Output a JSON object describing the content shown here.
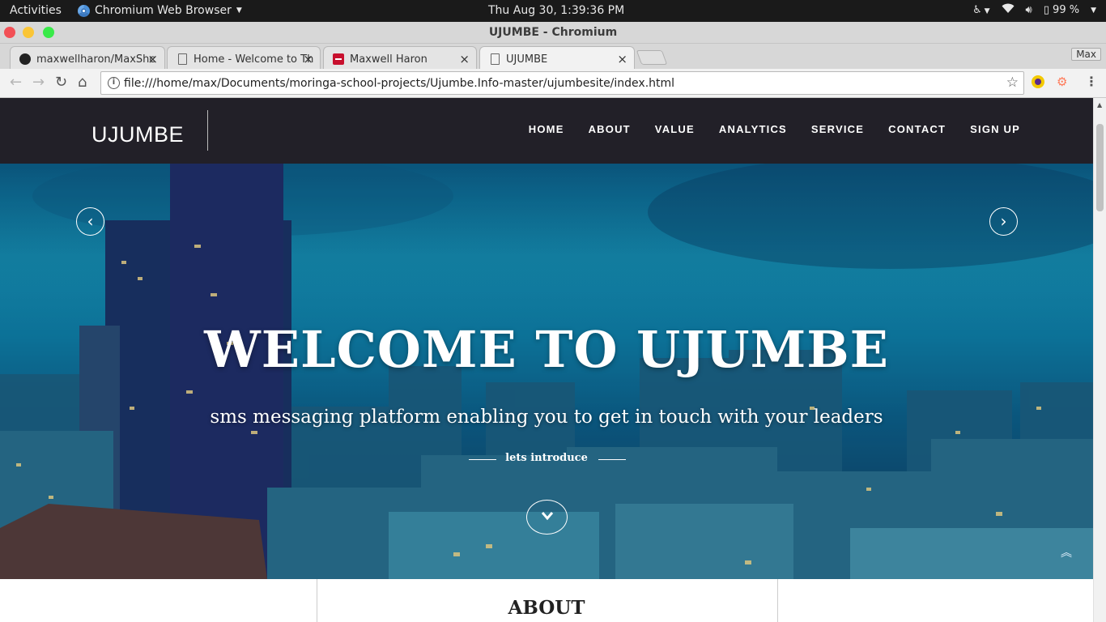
{
  "system_bar": {
    "activities": "Activities",
    "app_name": "Chromium Web Browser",
    "clock": "Thu Aug 30,  1:39:36 PM",
    "battery": "99 %"
  },
  "window": {
    "title": "UJUMBE - Chromium"
  },
  "tabs": [
    {
      "label": "maxwellharon/MaxShc",
      "icon": "github-icon"
    },
    {
      "label": "Home - Welcome to Th",
      "icon": "document-icon"
    },
    {
      "label": "Maxwell Haron",
      "icon": "red-site-icon"
    },
    {
      "label": "UJUMBE",
      "icon": "document-icon",
      "active": true
    }
  ],
  "profile": "Max",
  "address_bar": {
    "url": "file:///home/max/Documents/moringa-school-projects/Ujumbe.Info-master/ujumbesite/index.html"
  },
  "site": {
    "brand": "UJUMBE",
    "nav": [
      "HOME",
      "ABOUT",
      "VALUE",
      "ANALYTICS",
      "SERVICE",
      "CONTACT",
      "SIGN UP"
    ],
    "hero": {
      "title": "WELCOME TO UJUMBE",
      "subtitle": "sms messaging platform enabling you to get in touch with your leaders",
      "intro": "lets introduce"
    },
    "about_heading": "ABOUT"
  }
}
